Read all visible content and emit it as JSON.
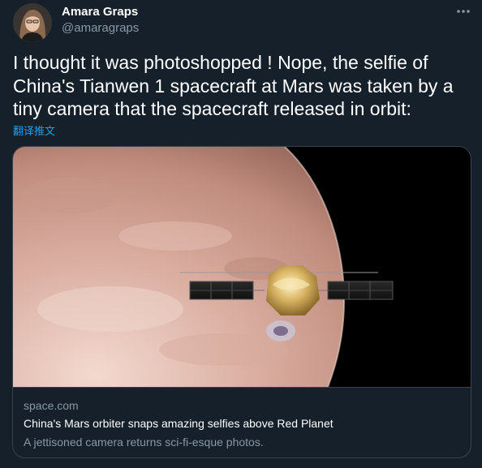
{
  "author": {
    "name": "Amara Graps",
    "handle": "@amaragraps"
  },
  "tweet": {
    "text": "I thought it was photoshopped !  Nope, the selfie of China's Tianwen 1 spacecraft at Mars was taken  by a tiny camera that the spacecraft released in orbit:",
    "translate_label": "翻译推文"
  },
  "card": {
    "domain": "space.com",
    "title": "China's Mars orbiter snaps amazing selfies above Red Planet",
    "description": "A jettisoned camera returns sci-fi-esque photos."
  },
  "icons": {
    "more": "more-horizontal-icon"
  },
  "colors": {
    "background": "#15202b",
    "secondary_text": "#8899a6",
    "link": "#1da1f2",
    "border": "#38444d"
  }
}
